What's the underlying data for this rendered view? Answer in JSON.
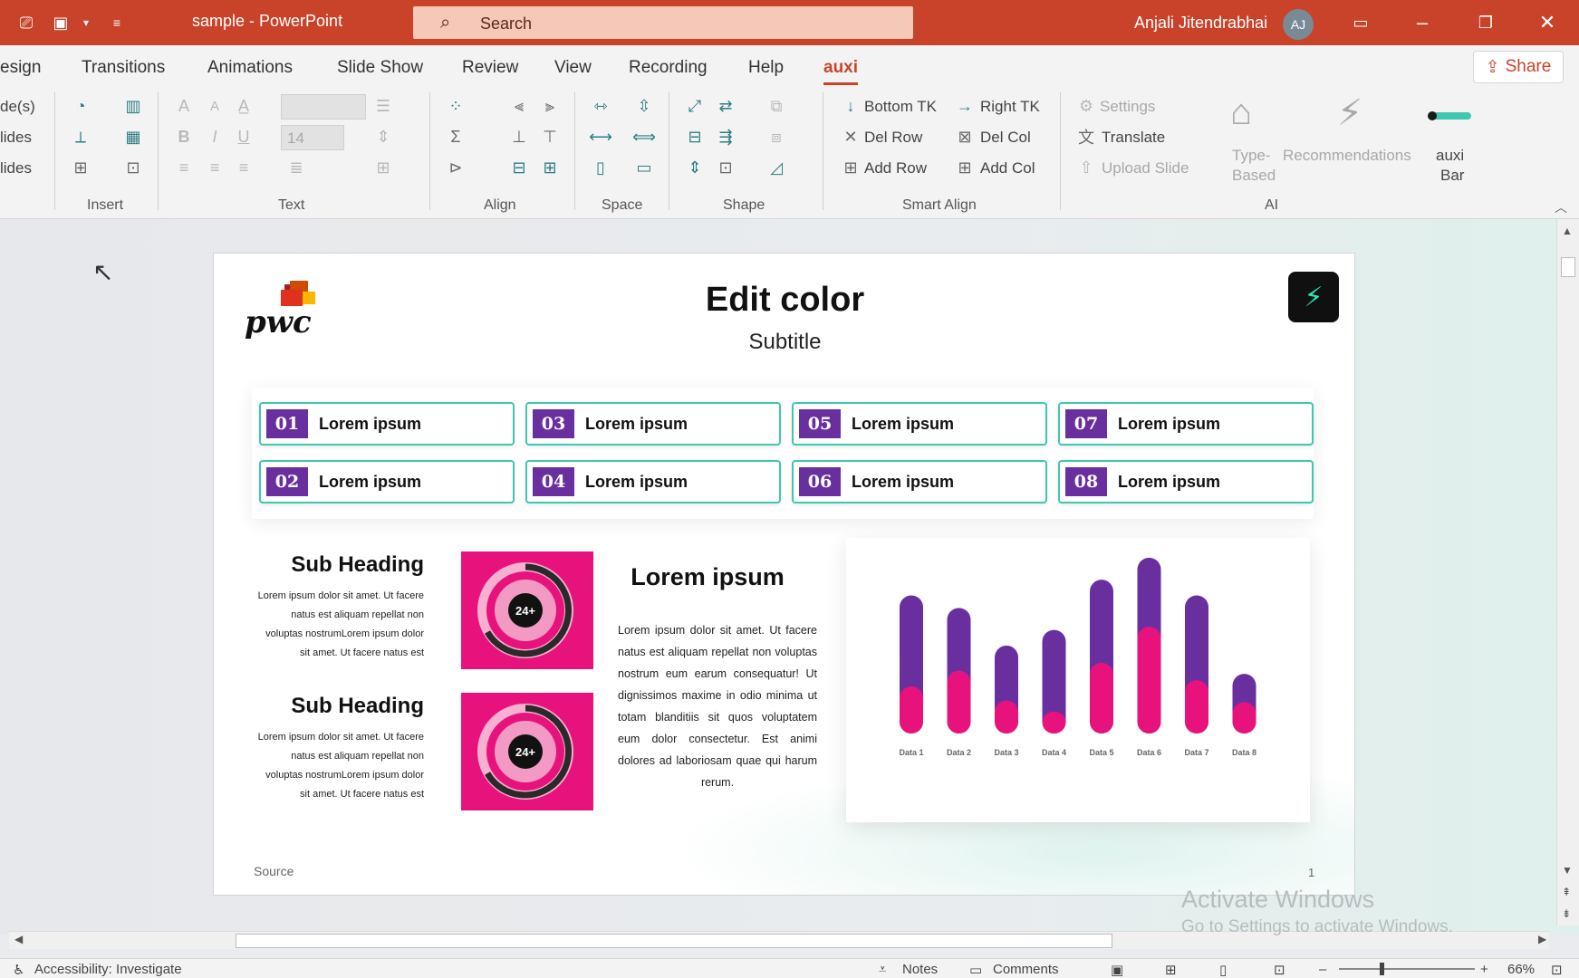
{
  "window": {
    "doc_title": "sample  -  PowerPoint",
    "search_placeholder": "Search",
    "user_name": "Anjali Jitendrabhai",
    "user_initials": "AJ"
  },
  "tabs": [
    {
      "label": "esign",
      "active": false
    },
    {
      "label": "Transitions",
      "active": false
    },
    {
      "label": "Animations",
      "active": false
    },
    {
      "label": "Slide Show",
      "active": false
    },
    {
      "label": "Review",
      "active": false
    },
    {
      "label": "View",
      "active": false
    },
    {
      "label": "Recording",
      "active": false
    },
    {
      "label": "Help",
      "active": false
    },
    {
      "label": "auxi",
      "active": true
    }
  ],
  "share_label": "Share",
  "ribbon": {
    "left_cut": [
      "de(s)",
      "lides",
      "lides"
    ],
    "groups": [
      "Insert",
      "Text",
      "Align",
      "Space",
      "Shape",
      "Smart Align",
      "AI"
    ],
    "font_size": "14",
    "smart_align": {
      "bottom_tk": "Bottom TK",
      "right_tk": "Right TK",
      "del_row": "Del Row",
      "del_col": "Del Col",
      "add_row": "Add Row",
      "add_col": "Add Col"
    },
    "ai": {
      "settings": "Settings",
      "translate": "Translate",
      "upload_slide": "Upload Slide",
      "type_based_1": "Type-",
      "type_based_2": "Based",
      "recommendations": "Recommendations",
      "auxi_bar_1": "auxi",
      "auxi_bar_2": "Bar"
    }
  },
  "slide": {
    "logo_text": "pwc",
    "title": "Edit color",
    "subtitle": "Subtitle",
    "items": [
      {
        "num": "01",
        "label": "Lorem ipsum"
      },
      {
        "num": "02",
        "label": "Lorem ipsum"
      },
      {
        "num": "03",
        "label": "Lorem ipsum"
      },
      {
        "num": "04",
        "label": "Lorem ipsum"
      },
      {
        "num": "05",
        "label": "Lorem ipsum"
      },
      {
        "num": "06",
        "label": "Lorem ipsum"
      },
      {
        "num": "07",
        "label": "Lorem ipsum"
      },
      {
        "num": "08",
        "label": "Lorem ipsum"
      }
    ],
    "sections": [
      {
        "heading": "Sub Heading",
        "text": "Lorem ipsum dolor sit amet. Ut facere natus est aliquam repellat non voluptas nostrumLorem ipsum dolor sit amet. Ut facere natus est",
        "gauge_label": "24+"
      },
      {
        "heading": "Sub Heading",
        "text": "Lorem ipsum dolor sit amet. Ut facere natus est aliquam repellat non voluptas nostrumLorem ipsum dolor sit amet. Ut facere natus est",
        "gauge_label": "24+"
      }
    ],
    "center_heading": "Lorem ipsum",
    "center_text": "Lorem ipsum dolor sit amet. Ut facere natus est aliquam repellat non voluptas nostrum eum earum consequatur! Ut dignissimos maxime in odio minima ut totam blanditiis sit quos voluptatem eum dolor consectetur. Est animi dolores ad laboriosam quae qui harum rerum.",
    "source": "Source",
    "page_number": "1"
  },
  "chart_data": {
    "type": "bar",
    "stacked": true,
    "categories": [
      "Data 1",
      "Data 2",
      "Data 3",
      "Data 4",
      "Data 5",
      "Data 6",
      "Data 7",
      "Data 8"
    ],
    "series": [
      {
        "values": [
          30,
          40,
          21,
          14,
          45,
          68,
          34,
          20
        ],
        "color": "#e8127c"
      },
      {
        "values": [
          58,
          40,
          35,
          52,
          53,
          44,
          54,
          18
        ],
        "color": "#6a2f9f"
      }
    ],
    "ylim": [
      0,
      120
    ],
    "grid": false,
    "legend": "none"
  },
  "watermark": {
    "line1": "Activate Windows",
    "line2": "Go to Settings to activate Windows."
  },
  "statusbar": {
    "accessibility": "Accessibility: Investigate",
    "notes": "Notes",
    "comments": "Comments",
    "zoom": "66%"
  },
  "colors": {
    "accent": "#c8432a",
    "purple": "#6a2f9f",
    "pink": "#e8127c",
    "teal": "#3fc7b0"
  }
}
